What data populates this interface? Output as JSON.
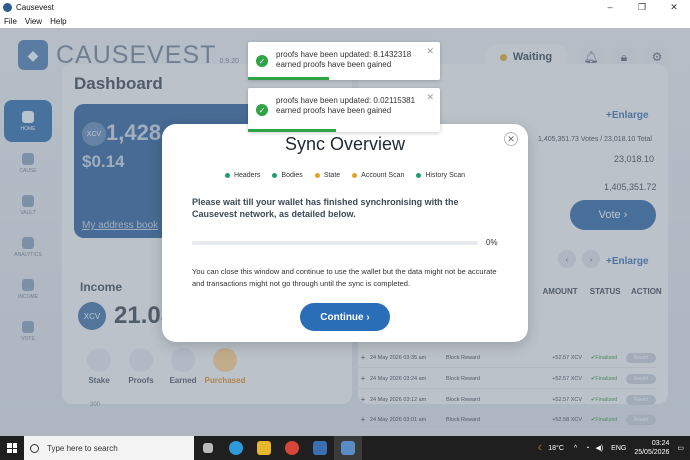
{
  "window": {
    "title": "Causevest",
    "menu": [
      "File",
      "View",
      "Help"
    ],
    "buttons": [
      "–",
      "❐",
      "✕"
    ]
  },
  "app": {
    "brand": "CAUSEVEST",
    "version": "0.9.20",
    "status": "Waiting",
    "sidebar": [
      "HOME",
      "CAUSE",
      "VAULT",
      "ANALYTICS",
      "INCOME",
      "VOTE"
    ],
    "dashboard_title": "Dashboard",
    "balance_big": "1,428,369.92",
    "balance_usd": "$0.14",
    "xcv_label": "XCV",
    "address_book": "My address book",
    "income_title": "Income",
    "income_value": "21.03",
    "tabs": [
      "Stake",
      "Proofs",
      "Earned",
      "Purchased"
    ],
    "small_label": "300",
    "enlarge": "+Enlarge",
    "stat_line1": "1,405,351.73 Votes / 23,018.10 Total",
    "stat_line2": "23,018.10",
    "stat_line3": "1,405,351.72",
    "vote_btn": "Vote ›",
    "table_headers": [
      "AMOUNT",
      "STATUS",
      "ACTION"
    ],
    "table_rows": [
      {
        "date": "24 May 2026 03:35 am",
        "type": "Block Reward",
        "amount": "+52.57 XCV",
        "status": "✔Finalized",
        "action": "Revert"
      },
      {
        "date": "24 May 2026 03:24 am",
        "type": "Block Reward",
        "amount": "+52.57 XCV",
        "status": "✔Finalized",
        "action": "Revert"
      },
      {
        "date": "24 May 2026 03:12 am",
        "type": "Block Reward",
        "amount": "+52.57 XCV",
        "status": "✔Finalized",
        "action": "Revert"
      },
      {
        "date": "24 May 2026 03:01 am",
        "type": "Block Reward",
        "amount": "+52.58 XCV",
        "status": "✔Finalized",
        "action": "Revert"
      }
    ]
  },
  "toasts": [
    {
      "text": "proofs have been updated: 8.1432318 earned proofs have been gained",
      "progress": 0.42
    },
    {
      "text": "proofs have been updated: 0.02115381 earned proofs have been gained",
      "progress": 0.46
    }
  ],
  "modal": {
    "title": "Sync Overview",
    "legend": [
      {
        "label": "Headers",
        "color": "#1f9c74"
      },
      {
        "label": "Bodies",
        "color": "#1f9c74"
      },
      {
        "label": "State",
        "color": "#e0a526"
      },
      {
        "label": "Account Scan",
        "color": "#e0a526"
      },
      {
        "label": "History Scan",
        "color": "#1f9c74"
      }
    ],
    "lead": "Please wait till your wallet has finished synchronising with the Causevest network, as detailed below.",
    "progress_percent": 0,
    "progress_label": "0%",
    "note": "You can close this window and continue to use the wallet but the data might not be accurate and transactions might not go through until the sync is completed.",
    "continue": "Continue ›",
    "close": "✕"
  },
  "taskbar": {
    "search_placeholder": "Type here to search",
    "weather": "18°C",
    "lang": "ENG",
    "time": "03:24",
    "date": "25/05/2026"
  }
}
